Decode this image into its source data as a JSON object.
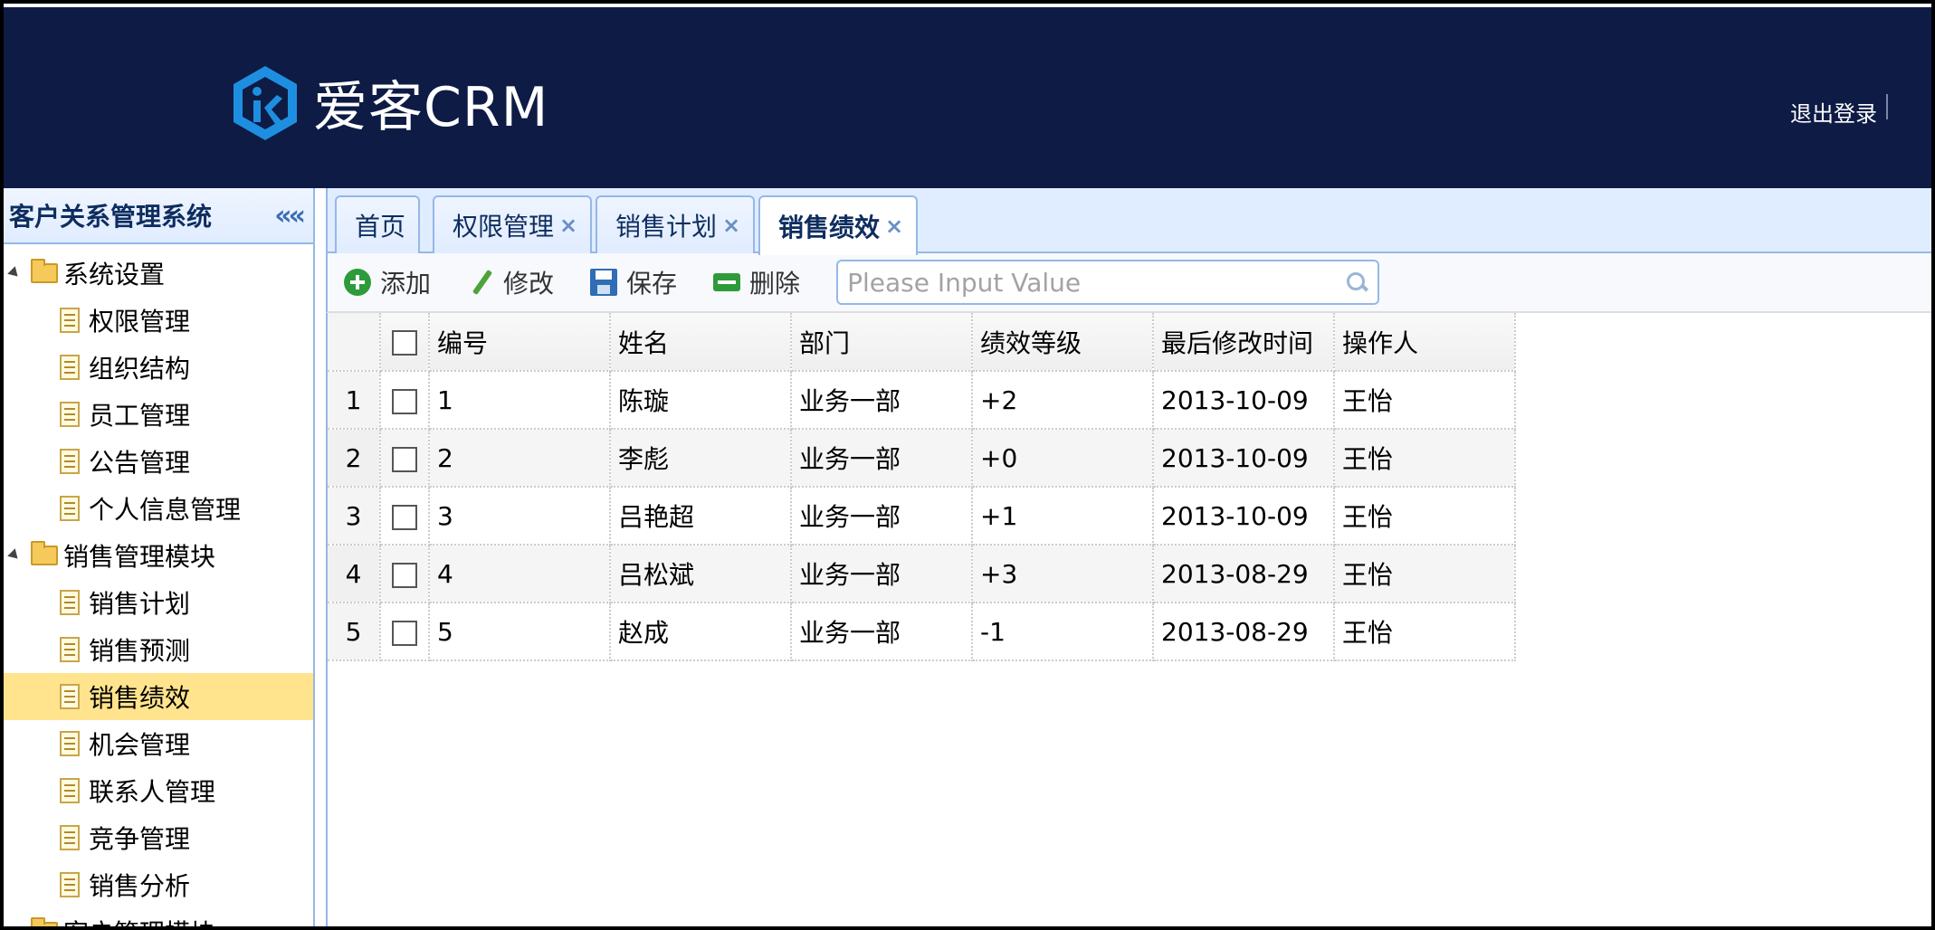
{
  "app": {
    "logo_text": "爱客CRM",
    "logout_label": "退出登录"
  },
  "sidebar": {
    "title": "客户关系管理系统",
    "groups": [
      {
        "label": "系统设置",
        "items": [
          "权限管理",
          "组织结构",
          "员工管理",
          "公告管理",
          "个人信息管理"
        ]
      },
      {
        "label": "销售管理模块",
        "items": [
          "销售计划",
          "销售预测",
          "销售绩效",
          "机会管理",
          "联系人管理",
          "竞争管理",
          "销售分析"
        ]
      },
      {
        "label": "客户管理模块"
      }
    ],
    "selected": "销售绩效"
  },
  "tabs": [
    {
      "label": "首页"
    },
    {
      "label": "权限管理",
      "close": "×"
    },
    {
      "label": "销售计划",
      "close": "×"
    },
    {
      "label": "销售绩效",
      "close": "×",
      "active": true
    }
  ],
  "toolbar": {
    "add_label": "添加",
    "edit_label": "修改",
    "save_label": "保存",
    "delete_label": "删除",
    "search_placeholder": "Please Input Value"
  },
  "table": {
    "columns": [
      "编号",
      "姓名",
      "部门",
      "绩效等级",
      "最后修改时间",
      "操作人"
    ],
    "rows": [
      {
        "num": "1",
        "id": "1",
        "name": "陈璇",
        "dept": "业务一部",
        "level": "+2",
        "time": "2013-10-09",
        "op": "王怡"
      },
      {
        "num": "2",
        "id": "2",
        "name": "李彪",
        "dept": "业务一部",
        "level": "+0",
        "time": "2013-10-09",
        "op": "王怡"
      },
      {
        "num": "3",
        "id": "3",
        "name": "吕艳超",
        "dept": "业务一部",
        "level": "+1",
        "time": "2013-10-09",
        "op": "王怡"
      },
      {
        "num": "4",
        "id": "4",
        "name": "吕松斌",
        "dept": "业务一部",
        "level": "+3",
        "time": "2013-08-29",
        "op": "王怡"
      },
      {
        "num": "5",
        "id": "5",
        "name": "赵成",
        "dept": "业务一部",
        "level": "-1",
        "time": "2013-08-29",
        "op": "王怡"
      }
    ]
  }
}
